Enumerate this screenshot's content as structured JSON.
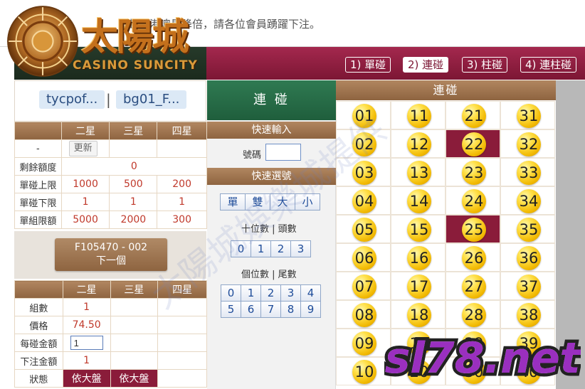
{
  "marquee": {
    "prefix": "",
    "text": "起，港澳星降倍，請各位會員踴躍下注。"
  },
  "logo": {
    "brand": "太陽城",
    "sub": "CASINO SUNCITY"
  },
  "tabs": [
    "1) 單碰",
    "2) 連碰",
    "3) 柱碰",
    "4) 連柱碰"
  ],
  "active_tab": 1,
  "users": {
    "user1": "tycpof...",
    "separator": "|",
    "user2": "bg01_F..."
  },
  "limits": {
    "headers": [
      "",
      "二星",
      "三星",
      "四星"
    ],
    "dash": "-",
    "update_label": "更新",
    "rows": [
      {
        "label": "剩餘額度",
        "value": "0"
      },
      {
        "label": "單碰上限",
        "values": [
          "1000",
          "500",
          "200"
        ]
      },
      {
        "label": "單碰下限",
        "values": [
          "1",
          "1",
          "1"
        ]
      },
      {
        "label": "單組限額",
        "values": [
          "5000",
          "2000",
          "300"
        ]
      }
    ]
  },
  "action": {
    "code": "F105470 - 002",
    "next": "下一個"
  },
  "bet": {
    "headers": [
      "",
      "二星",
      "三星",
      "四星"
    ],
    "groups_label": "組數",
    "groups_value": "1",
    "price_label": "價格",
    "price_value": "74.50",
    "amount_label": "每碰金額",
    "amount_value": "1",
    "total_label": "下注金額",
    "total_value": "1",
    "status_label": "狀態",
    "status_values": [
      "依大盤",
      "依大盤"
    ]
  },
  "middle": {
    "title": "連 碰",
    "quick_input": "快速輸入",
    "number_label": "號碼",
    "quick_select": "快速選號",
    "type_buttons": [
      "單",
      "雙",
      "大",
      "小"
    ],
    "tens_label": "十位數 | 頭數",
    "tens_buttons": [
      "0",
      "1",
      "2",
      "3"
    ],
    "units_label": "個位數 | 尾數",
    "units_row1": [
      "0",
      "1",
      "2",
      "3",
      "4"
    ],
    "units_row2": [
      "5",
      "6",
      "7",
      "8",
      "9"
    ]
  },
  "numbers": {
    "header": "連碰",
    "columns": [
      [
        "01",
        "02",
        "03",
        "04",
        "05",
        "06",
        "07",
        "08",
        "09",
        "10"
      ],
      [
        "11",
        "12",
        "13",
        "14",
        "15",
        "16",
        "17",
        "18",
        "19",
        "20"
      ],
      [
        "21",
        "22",
        "23",
        "24",
        "25",
        "26",
        "27",
        "28",
        "29",
        "30"
      ],
      [
        "31",
        "32",
        "33",
        "34",
        "35",
        "36",
        "37",
        "38",
        "39",
        "40"
      ]
    ],
    "selected": [
      "22",
      "25"
    ]
  },
  "watermark": {
    "text": "太陽城娛樂城提供",
    "site": "sl78.net"
  }
}
